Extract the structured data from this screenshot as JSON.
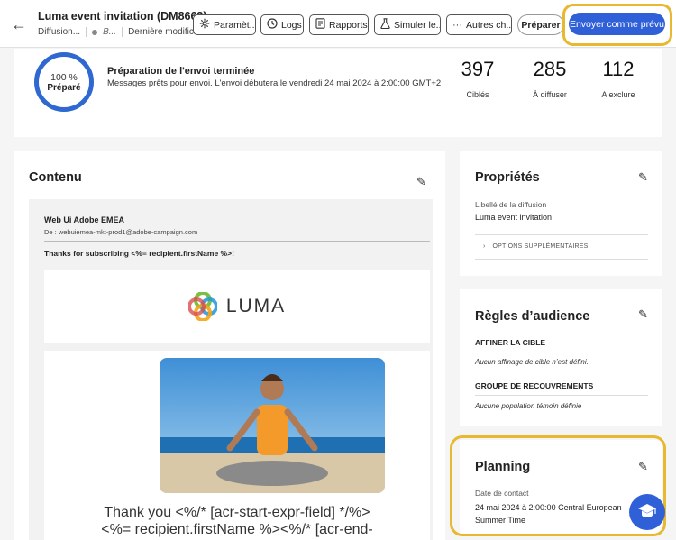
{
  "header": {
    "back_icon": "arrow-left-icon",
    "title": "Luma event invitation (DM8663)",
    "meta_type": "Diffusion...",
    "meta_status": "B...",
    "meta_modified": "Dernière modifica...",
    "toolbar": {
      "settings": "Paramèt...",
      "logs": "Logs",
      "reports": "Rapports",
      "simulate": "Simuler le...",
      "more": "Autres ch...",
      "prepare": "Préparer",
      "send": "Envoyer comme prévu"
    }
  },
  "summary": {
    "progress_value": 100,
    "progress_label": "100 %",
    "progress_state": "Préparé",
    "title": "Préparation de l'envoi terminée",
    "subtitle": "Messages prêts pour envoi. L'envoi débutera le vendredi 24 mai 2024 à 2:00:00 GMT+2",
    "stats": [
      {
        "value": "397",
        "label": "Ciblés"
      },
      {
        "value": "285",
        "label": "À diffuser"
      },
      {
        "value": "112",
        "label": "A exclure"
      }
    ]
  },
  "content": {
    "title": "Contenu",
    "preview": {
      "from_name": "Web Ui Adobe EMEA",
      "from": "De : webuiemea-mkt-prod1@adobe-campaign.com",
      "subject": "Thanks for subscribing <%= recipient.firstName %>!",
      "logo_text": "LUMA",
      "thanks_line1": "Thank you <%/* [acr-start-expr-field] */%>",
      "thanks_line2": "<%= recipient.firstName %><%/* [acr-end-"
    }
  },
  "properties": {
    "title": "Propriétés",
    "label": "Libellé de la diffusion",
    "value": "Luma event invitation",
    "more": "OPTIONS SUPPLÉMENTAIRES"
  },
  "audience": {
    "title": "Règles d’audience",
    "refine_head": "AFFINER LA CIBLE",
    "refine_val": "Aucun affinage de cible n’est défini.",
    "overlap_head": "GROUPE DE RECOUVREMENTS",
    "overlap_val": "Aucune population témoin définie"
  },
  "planning": {
    "title": "Planning",
    "label": "Date de contact",
    "value_line1": "24 mai 2024 à 2:00:00 Central European",
    "value_line2": "Summer Time"
  },
  "colors": {
    "accent": "#2f60d8",
    "highlight": "#e8b830",
    "progress": "#2e68d0"
  }
}
